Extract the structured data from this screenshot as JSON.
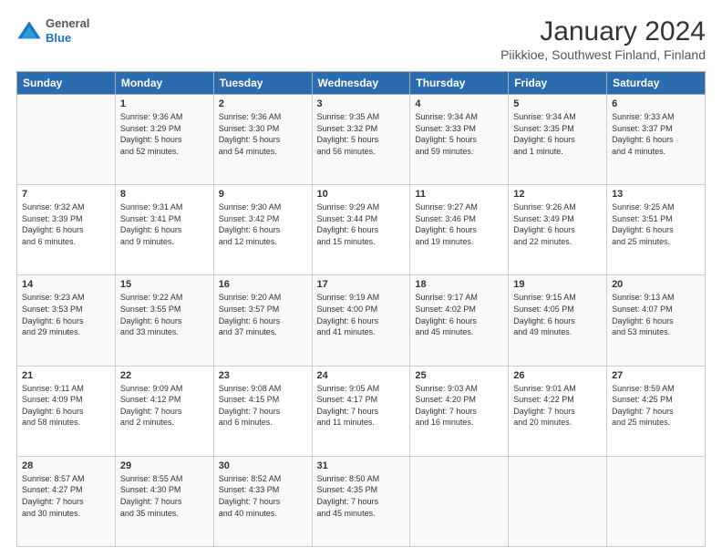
{
  "header": {
    "logo": {
      "general": "General",
      "blue": "Blue"
    },
    "title": "January 2024",
    "subtitle": "Piikkioe, Southwest Finland, Finland"
  },
  "days_of_week": [
    "Sunday",
    "Monday",
    "Tuesday",
    "Wednesday",
    "Thursday",
    "Friday",
    "Saturday"
  ],
  "weeks": [
    [
      {
        "day": "",
        "info": ""
      },
      {
        "day": "1",
        "info": "Sunrise: 9:36 AM\nSunset: 3:29 PM\nDaylight: 5 hours\nand 52 minutes."
      },
      {
        "day": "2",
        "info": "Sunrise: 9:36 AM\nSunset: 3:30 PM\nDaylight: 5 hours\nand 54 minutes."
      },
      {
        "day": "3",
        "info": "Sunrise: 9:35 AM\nSunset: 3:32 PM\nDaylight: 5 hours\nand 56 minutes."
      },
      {
        "day": "4",
        "info": "Sunrise: 9:34 AM\nSunset: 3:33 PM\nDaylight: 5 hours\nand 59 minutes."
      },
      {
        "day": "5",
        "info": "Sunrise: 9:34 AM\nSunset: 3:35 PM\nDaylight: 6 hours\nand 1 minute."
      },
      {
        "day": "6",
        "info": "Sunrise: 9:33 AM\nSunset: 3:37 PM\nDaylight: 6 hours\nand 4 minutes."
      }
    ],
    [
      {
        "day": "7",
        "info": "Sunrise: 9:32 AM\nSunset: 3:39 PM\nDaylight: 6 hours\nand 6 minutes."
      },
      {
        "day": "8",
        "info": "Sunrise: 9:31 AM\nSunset: 3:41 PM\nDaylight: 6 hours\nand 9 minutes."
      },
      {
        "day": "9",
        "info": "Sunrise: 9:30 AM\nSunset: 3:42 PM\nDaylight: 6 hours\nand 12 minutes."
      },
      {
        "day": "10",
        "info": "Sunrise: 9:29 AM\nSunset: 3:44 PM\nDaylight: 6 hours\nand 15 minutes."
      },
      {
        "day": "11",
        "info": "Sunrise: 9:27 AM\nSunset: 3:46 PM\nDaylight: 6 hours\nand 19 minutes."
      },
      {
        "day": "12",
        "info": "Sunrise: 9:26 AM\nSunset: 3:49 PM\nDaylight: 6 hours\nand 22 minutes."
      },
      {
        "day": "13",
        "info": "Sunrise: 9:25 AM\nSunset: 3:51 PM\nDaylight: 6 hours\nand 25 minutes."
      }
    ],
    [
      {
        "day": "14",
        "info": "Sunrise: 9:23 AM\nSunset: 3:53 PM\nDaylight: 6 hours\nand 29 minutes."
      },
      {
        "day": "15",
        "info": "Sunrise: 9:22 AM\nSunset: 3:55 PM\nDaylight: 6 hours\nand 33 minutes."
      },
      {
        "day": "16",
        "info": "Sunrise: 9:20 AM\nSunset: 3:57 PM\nDaylight: 6 hours\nand 37 minutes."
      },
      {
        "day": "17",
        "info": "Sunrise: 9:19 AM\nSunset: 4:00 PM\nDaylight: 6 hours\nand 41 minutes."
      },
      {
        "day": "18",
        "info": "Sunrise: 9:17 AM\nSunset: 4:02 PM\nDaylight: 6 hours\nand 45 minutes."
      },
      {
        "day": "19",
        "info": "Sunrise: 9:15 AM\nSunset: 4:05 PM\nDaylight: 6 hours\nand 49 minutes."
      },
      {
        "day": "20",
        "info": "Sunrise: 9:13 AM\nSunset: 4:07 PM\nDaylight: 6 hours\nand 53 minutes."
      }
    ],
    [
      {
        "day": "21",
        "info": "Sunrise: 9:11 AM\nSunset: 4:09 PM\nDaylight: 6 hours\nand 58 minutes."
      },
      {
        "day": "22",
        "info": "Sunrise: 9:09 AM\nSunset: 4:12 PM\nDaylight: 7 hours\nand 2 minutes."
      },
      {
        "day": "23",
        "info": "Sunrise: 9:08 AM\nSunset: 4:15 PM\nDaylight: 7 hours\nand 6 minutes."
      },
      {
        "day": "24",
        "info": "Sunrise: 9:05 AM\nSunset: 4:17 PM\nDaylight: 7 hours\nand 11 minutes."
      },
      {
        "day": "25",
        "info": "Sunrise: 9:03 AM\nSunset: 4:20 PM\nDaylight: 7 hours\nand 16 minutes."
      },
      {
        "day": "26",
        "info": "Sunrise: 9:01 AM\nSunset: 4:22 PM\nDaylight: 7 hours\nand 20 minutes."
      },
      {
        "day": "27",
        "info": "Sunrise: 8:59 AM\nSunset: 4:25 PM\nDaylight: 7 hours\nand 25 minutes."
      }
    ],
    [
      {
        "day": "28",
        "info": "Sunrise: 8:57 AM\nSunset: 4:27 PM\nDaylight: 7 hours\nand 30 minutes."
      },
      {
        "day": "29",
        "info": "Sunrise: 8:55 AM\nSunset: 4:30 PM\nDaylight: 7 hours\nand 35 minutes."
      },
      {
        "day": "30",
        "info": "Sunrise: 8:52 AM\nSunset: 4:33 PM\nDaylight: 7 hours\nand 40 minutes."
      },
      {
        "day": "31",
        "info": "Sunrise: 8:50 AM\nSunset: 4:35 PM\nDaylight: 7 hours\nand 45 minutes."
      },
      {
        "day": "",
        "info": ""
      },
      {
        "day": "",
        "info": ""
      },
      {
        "day": "",
        "info": ""
      }
    ]
  ]
}
